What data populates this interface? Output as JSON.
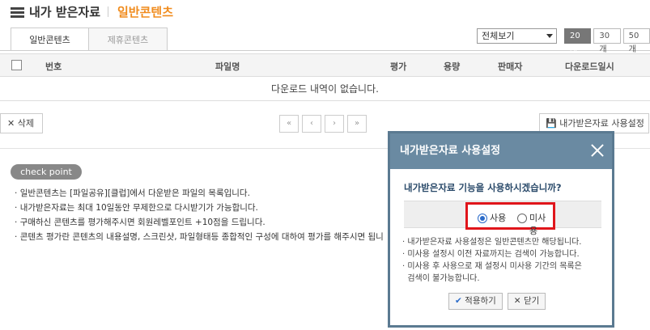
{
  "header": {
    "title": "내가 받은자료",
    "subtitle": "일반콘텐츠"
  },
  "tabs": [
    {
      "label": "일반콘텐츠",
      "active": true
    },
    {
      "label": "제휴콘텐츠",
      "active": false
    }
  ],
  "filter": {
    "view_select": "전체보기",
    "counts": [
      "20개",
      "30개",
      "50개"
    ],
    "active_count": "20개"
  },
  "table": {
    "columns": [
      "번호",
      "파일명",
      "평가",
      "용량",
      "판매자",
      "다운로드일시"
    ],
    "empty_message": "다운로드 내역이 없습니다."
  },
  "actions": {
    "delete_label": "삭제",
    "setting_label": "내가받은자료 사용설정",
    "pager": [
      "«",
      "‹",
      "›",
      "»"
    ]
  },
  "checkpoint": {
    "badge": "check point",
    "items": [
      "일반콘텐츠는 [파일공유][클럽]에서 다운받은 파일의 목록입니다.",
      "내가받은자료는 최대 10일동안 무제한으로 다시받기가 가능합니다.",
      "구매하신 콘텐츠를 평가해주시면 회원레벨포인트 +10점을 드립니다.",
      "콘텐츠 평가란 콘텐츠의 내용설명, 스크린샷, 파일형태등 종합적인 구성에 대하여 평가를 해주시면 됩니"
    ]
  },
  "dialog": {
    "title": "내가받은자료 사용설정",
    "question": "내가받은자료 기능을 사용하시겠습니까?",
    "option_use": "사용",
    "option_nouse": "미사용",
    "selected": "사용",
    "notes": [
      "내가받은자료 사용설정은 일반콘텐츠만 해당됩니다.",
      "미사용 설정시 이전 자료까지는 검색이 가능합니다.",
      "미사용 후 사용으로 재 설정시 미사용 기간의 목록은",
      "검색이 불가능합니다."
    ],
    "apply_label": "적용하기",
    "close_label": "닫기"
  }
}
